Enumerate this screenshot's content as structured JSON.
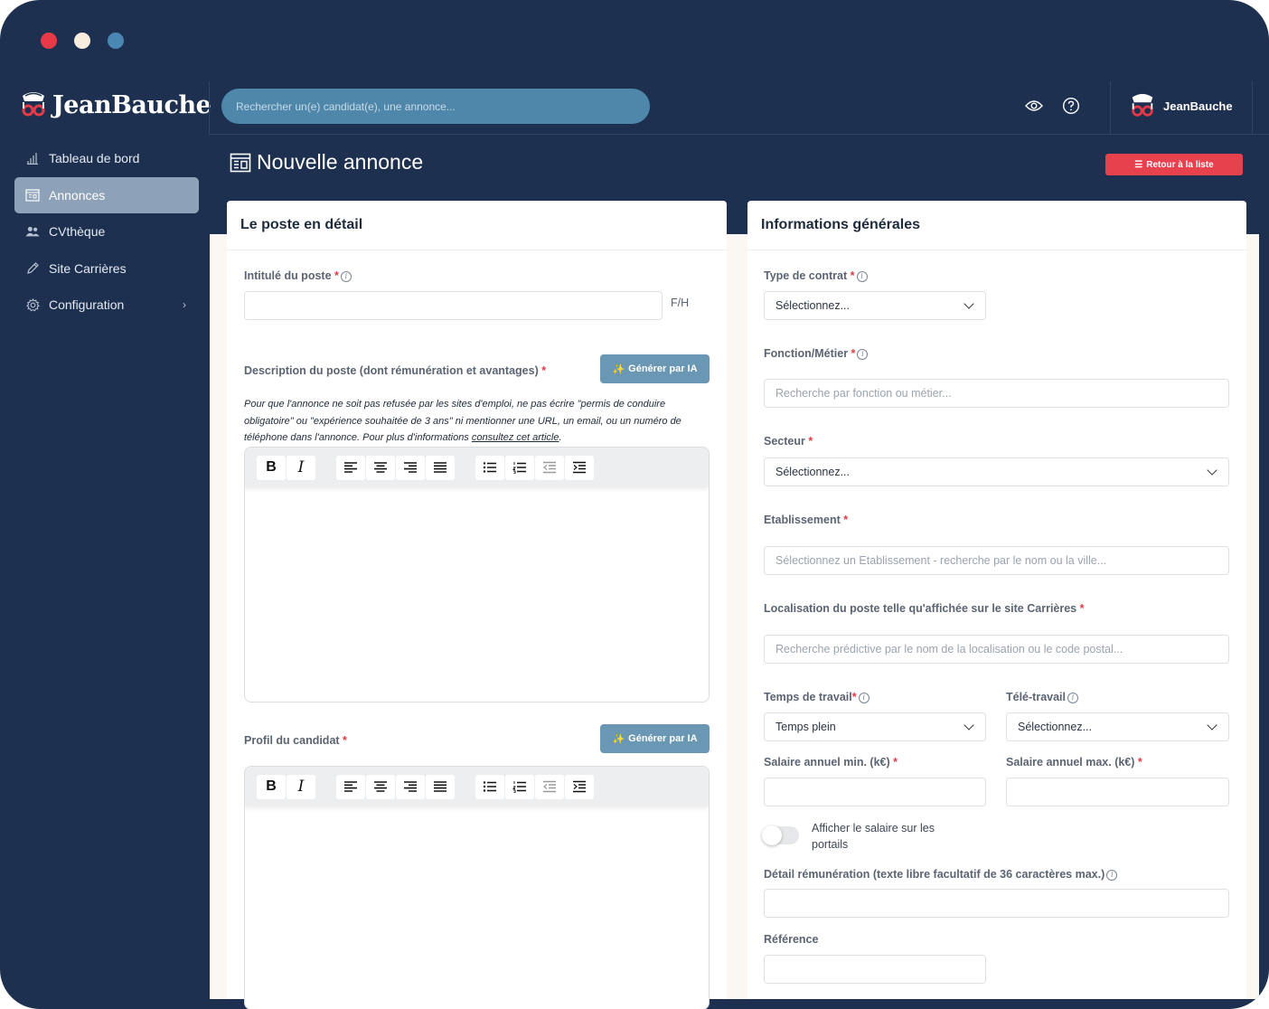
{
  "app": {
    "logo_text": "JeanBauche"
  },
  "sidebar": {
    "items": [
      {
        "label": "Tableau de bord",
        "icon": "bar-chart-icon"
      },
      {
        "label": "Annonces",
        "icon": "listing-icon",
        "active": true
      },
      {
        "label": "CVthèque",
        "icon": "users-icon"
      },
      {
        "label": "Site Carrières",
        "icon": "pen-icon"
      },
      {
        "label": "Configuration",
        "icon": "gear-icon"
      }
    ]
  },
  "header": {
    "search_placeholder": "Rechercher un(e) candidat(e), une annonce...",
    "user_name": "JeanBauche"
  },
  "page": {
    "title": "Nouvelle annonce",
    "back_button": "Retour à la liste"
  },
  "left_card": {
    "title": "Le poste en détail",
    "job_title_label": "Intitulé du poste",
    "job_title_suffix": "F/H",
    "description_label": "Description du poste (dont rémunération et avantages)",
    "ai_button": "Générer par IA",
    "hint_text": "Pour que l'annonce ne soit pas refusée par les sites d'emploi, ne pas écrire \"permis de conduire obligatoire\" ou \"expérience souhaitée de 3 ans\" ni mentionner une URL, un email, ou un numéro de téléphone dans l'annonce. Pour plus d'informations",
    "hint_link": "consultez cet article",
    "profile_label": "Profil du candidat"
  },
  "right_card": {
    "title": "Informations générales",
    "contract_label": "Type de contrat",
    "contract_value": "Sélectionnez...",
    "function_label": "Fonction/Métier",
    "function_placeholder": "Recherche par fonction ou métier...",
    "sector_label": "Secteur",
    "sector_value": "Sélectionnez...",
    "establishment_label": "Etablissement",
    "establishment_placeholder": "Sélectionnez un Etablissement - recherche par le nom ou la ville...",
    "location_label": "Localisation du poste telle qu'affichée sur le site Carrières",
    "location_placeholder": "Recherche prédictive par le nom de la localisation ou le code postal...",
    "worktime_label": "Temps de travail",
    "worktime_value": "Temps plein",
    "remote_label": "Télé-travail",
    "remote_value": "Sélectionnez...",
    "salary_min_label": "Salaire annuel min. (k€)",
    "salary_max_label": "Salaire annuel max. (k€)",
    "show_salary_label": "Afficher le salaire sur les portails",
    "show_salary_on": false,
    "pay_detail_label": "Détail rémunération (texte libre facultatif de 36 caractères max.)",
    "reference_label": "Référence"
  },
  "colors": {
    "background": "#1d3050",
    "accent_red": "#e8414e",
    "ai_button": "#6a97b4",
    "search": "#4f87ab"
  }
}
